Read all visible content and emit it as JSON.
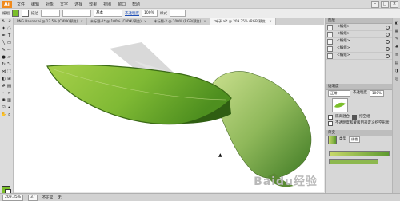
{
  "app": {
    "logo": "Ai",
    "menus": [
      "文件",
      "编辑",
      "对象",
      "文字",
      "选择",
      "效果",
      "视图",
      "窗口",
      "帮助"
    ],
    "window_buttons": [
      "–",
      "□",
      "×"
    ]
  },
  "control_bar": {
    "selection_label": "编组",
    "stroke_label": "描边",
    "style_label": "基本",
    "opacity_label": "不透明度",
    "opacity_value": "100%",
    "style2_label": "样式",
    "fill_color": "#7bbf2a"
  },
  "tabs": [
    {
      "label": "PNG Banner.ai @ 12.5% (CMYK/预览)",
      "active": false
    },
    {
      "label": "未标题-1* @ 100% (CMYK/预览)",
      "active": false
    },
    {
      "label": "未标题-2 @ 100% (RGB/预览)",
      "active": false
    },
    {
      "label": "*叶子.ai* @ 209.35% (RGB/预览)",
      "active": true
    }
  ],
  "layers_panel": {
    "title": "图层",
    "rows": [
      "<编组>",
      "<编组>",
      "<编组>",
      "<编组>",
      "<编组>"
    ]
  },
  "transparency_panel": {
    "title": "透明度",
    "blend_mode": "正常",
    "opacity": "不透明度",
    "opacity_value": "100%",
    "options": [
      "隔离混合",
      "挖空组",
      "不透明度和蒙版用来定义挖空形状"
    ]
  },
  "gradient_panel": {
    "title": "渐变",
    "type_label": "类型",
    "type_value": "线性",
    "start_color": "#c8d96a",
    "end_color": "#5d9a2f"
  },
  "status_bar": {
    "zoom": "209.35%",
    "page": "37",
    "status_text": "不正常",
    "selection_text": "无"
  },
  "watermark": "Baidu经验",
  "colors": {
    "leaf_light": "#a7d04a",
    "leaf_dark": "#4e8f1f",
    "leaf_shadow": "#2f5e12",
    "leaf_pale": "#c9df8d",
    "shadow_grey": "#d4d4d4"
  }
}
